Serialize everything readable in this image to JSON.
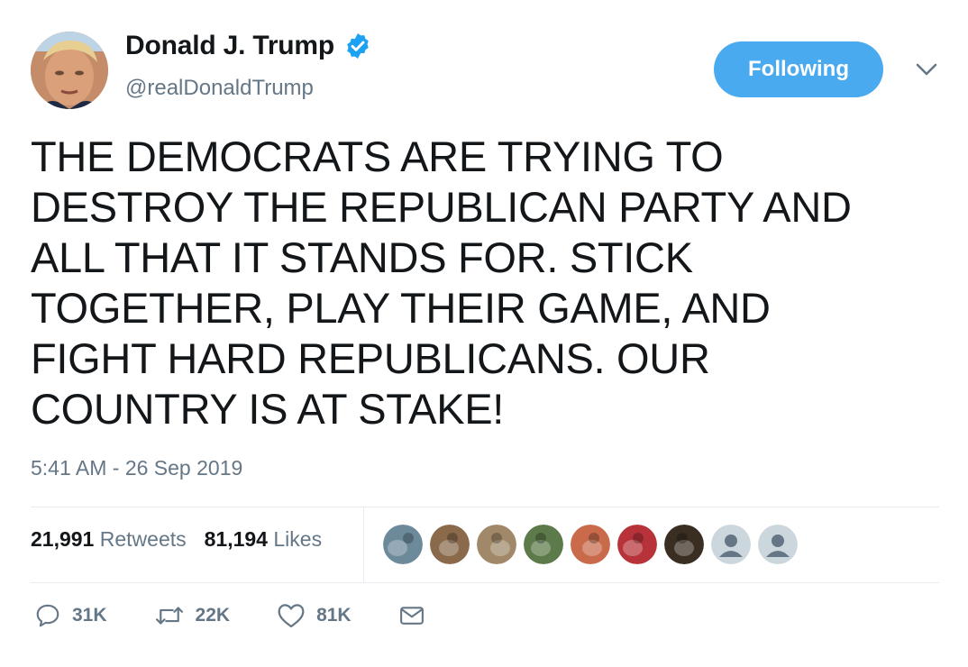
{
  "author": {
    "name": "Donald J. Trump",
    "handle": "@realDonaldTrump",
    "verified": true
  },
  "follow_button": {
    "label": "Following",
    "color": "#4aaaf0"
  },
  "tweet": {
    "lines": [
      "THE DEMOCRATS ARE TRYING TO",
      "DESTROY THE REPUBLICAN PARTY AND",
      "ALL THAT IT STANDS FOR. STICK",
      "TOGETHER, PLAY THEIR GAME, AND",
      "FIGHT HARD REPUBLICANS. OUR",
      "COUNTRY IS AT STAKE!"
    ],
    "timestamp": "5:41 AM - 26 Sep 2019"
  },
  "stats": {
    "retweets_count": "21,991",
    "retweets_label": "Retweets",
    "likes_count": "81,194",
    "likes_label": "Likes"
  },
  "likers": [
    {
      "type": "photo",
      "color": "#6d8a9a"
    },
    {
      "type": "photo",
      "color": "#8a6a4a"
    },
    {
      "type": "photo",
      "color": "#a08868"
    },
    {
      "type": "photo",
      "color": "#5c7a4a"
    },
    {
      "type": "photo",
      "color": "#c96a4a"
    },
    {
      "type": "photo",
      "color": "#b8323a"
    },
    {
      "type": "photo",
      "color": "#3a2e22"
    },
    {
      "type": "default",
      "color": "#ccd6dd"
    },
    {
      "type": "default",
      "color": "#ccd6dd"
    }
  ],
  "actions": {
    "reply_count": "31K",
    "retweet_count": "22K",
    "like_count": "81K"
  },
  "icons": {
    "verified": "verified-badge-icon",
    "caret": "chevron-down-icon",
    "reply": "reply-icon",
    "retweet": "retweet-icon",
    "like": "heart-icon",
    "message": "envelope-icon"
  },
  "colors": {
    "text": "#14171a",
    "secondary": "#657786",
    "accent": "#1da1f2",
    "divider": "#e6ecf0"
  }
}
